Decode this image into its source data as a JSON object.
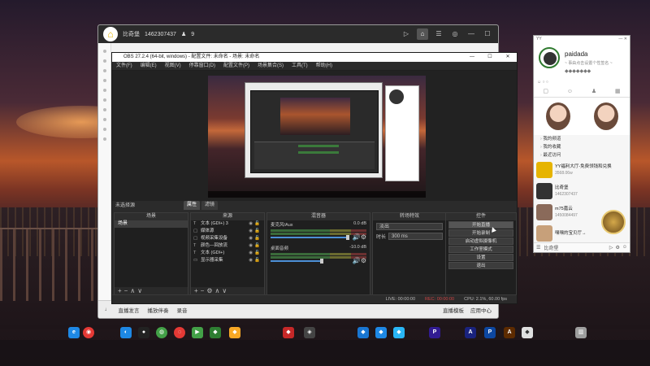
{
  "qq": {
    "top": {
      "name": "比奇堡",
      "id": "1462307437",
      "count": "9"
    },
    "bottom": {
      "items": [
        "直播发言",
        "播放伴奏",
        "录音"
      ],
      "right": [
        "直播模板",
        "应用中心"
      ]
    }
  },
  "obs": {
    "title": "OBS 27.2.4 (64-bit, windows) - 配置文件: 未命名 - 场景: 未命名",
    "window_buttons": [
      "—",
      "☐",
      "✕"
    ],
    "menu": [
      "文件(F)",
      "编辑(E)",
      "视图(V)",
      "停靠窗口(D)",
      "配置文件(P)",
      "场景集合(S)",
      "工具(T)",
      "帮助(H)"
    ],
    "no_source": "未选择源",
    "tabs": [
      "属性",
      "滤镜"
    ],
    "panels": {
      "scenes": "场景",
      "sources": "来源",
      "mixer": "混音器",
      "transitions": "转场特效",
      "controls": "控件"
    },
    "scenes": [
      "场景"
    ],
    "sources": [
      {
        "icon": "T",
        "name": "文本 (GDI+) 3"
      },
      {
        "icon": "▢",
        "name": "媒体源"
      },
      {
        "icon": "▢",
        "name": "视频采集设备"
      },
      {
        "icon": "T",
        "name": "颜色—回放流"
      },
      {
        "icon": "T",
        "name": "文本 (GDI+)"
      },
      {
        "icon": "▭",
        "name": "显示器采集"
      }
    ],
    "mixer": [
      {
        "name": "麦克风/Aux",
        "db": "0.0 dB"
      },
      {
        "name": "桌面音频",
        "db": "-10.0 dB"
      }
    ],
    "transition": {
      "type": "淡出",
      "duration_label": "时长",
      "duration": "300 ms"
    },
    "controls": [
      "开始直播",
      "开始录制",
      "启动虚拟摄像机",
      "工作室模式",
      "设置",
      "退出"
    ],
    "status": {
      "live": "LIVE: 00:00:00",
      "rec": "REC: 00:00:00",
      "cpu": "CPU: 2.1%, 60.00 fps"
    }
  },
  "buddy": {
    "title": "YY",
    "name": "paidada",
    "signature": "~ 事由点击设置个性签名 ~",
    "tabs": [
      "▢",
      "☺",
      "♟",
      "▦"
    ],
    "groups": [
      "我的频道",
      "我的收藏",
      "最近访问"
    ],
    "items": [
      {
        "name": "YY福利大厅-免费领钱和兑换",
        "sub": "3568.06w"
      },
      {
        "name": "比奇堡",
        "sub": "1462307437"
      },
      {
        "name": "m75嘉云",
        "sub": "1450084497"
      },
      {
        "name": "嘿嘿的宝贝厅→",
        "sub": ""
      }
    ],
    "foot": "比奇堡"
  },
  "colors": {
    "obs_bg": "#2b2b2b",
    "accent_green": "#3a6a3a",
    "qq_accent": "#e6b400"
  }
}
